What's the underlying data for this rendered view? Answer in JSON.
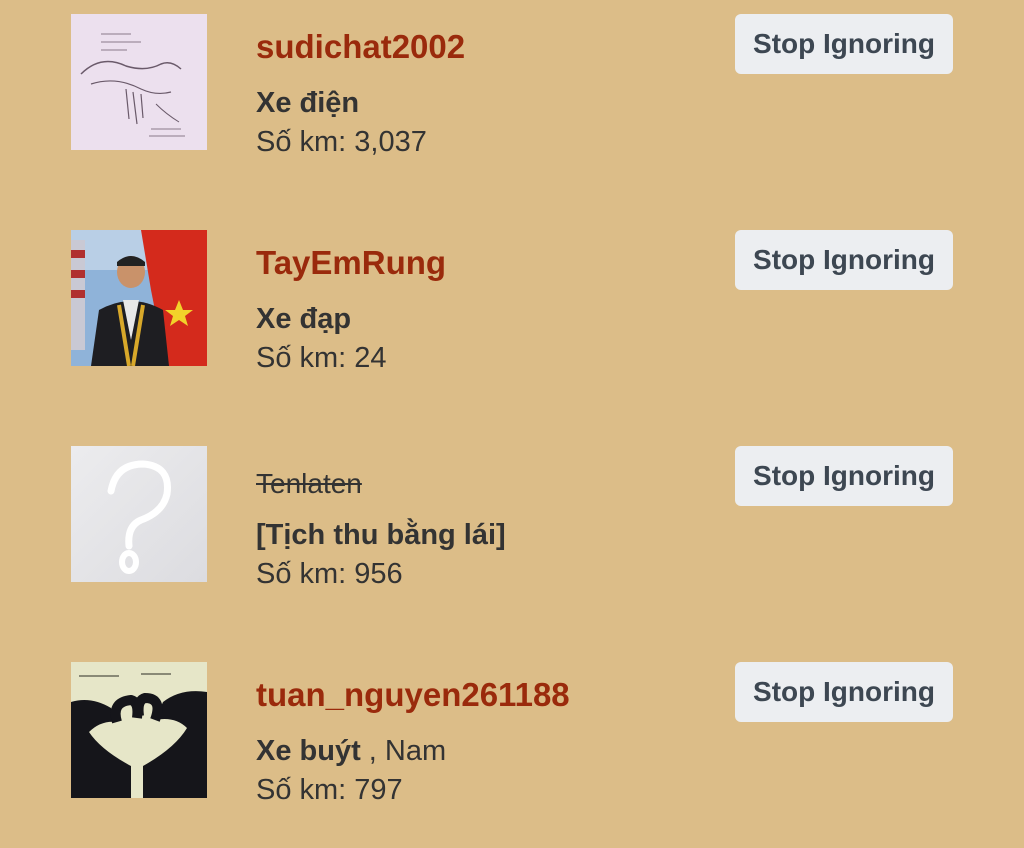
{
  "ignored_users": [
    {
      "username": "sudichat2002",
      "title": "Xe điện",
      "location": "",
      "km": "Số km: 3,037",
      "button": "Stop Ignoring",
      "avatar": "sketch-avatar",
      "banned": false
    },
    {
      "username": "TayEmRung",
      "title": "Xe đạp",
      "location": "",
      "km": "Số km: 24",
      "button": "Stop Ignoring",
      "avatar": "photo-avatar",
      "banned": false
    },
    {
      "username": "Tenlaten",
      "title": "[Tịch thu bằng lái]",
      "location": "",
      "km": "Số km: 956",
      "button": "Stop Ignoring",
      "avatar": "question-mark-avatar",
      "banned": true
    },
    {
      "username": "tuan_nguyen261188",
      "title": "Xe buýt",
      "location": " , Nam",
      "km": "Số km: 797",
      "button": "Stop Ignoring",
      "avatar": "heart-hands-avatar",
      "banned": false
    }
  ],
  "colors": {
    "page_background": "#dcbd88",
    "username": "#9a2a0c",
    "text": "#333333",
    "button_background": "#eceef1",
    "button_text": "#3d4752"
  }
}
